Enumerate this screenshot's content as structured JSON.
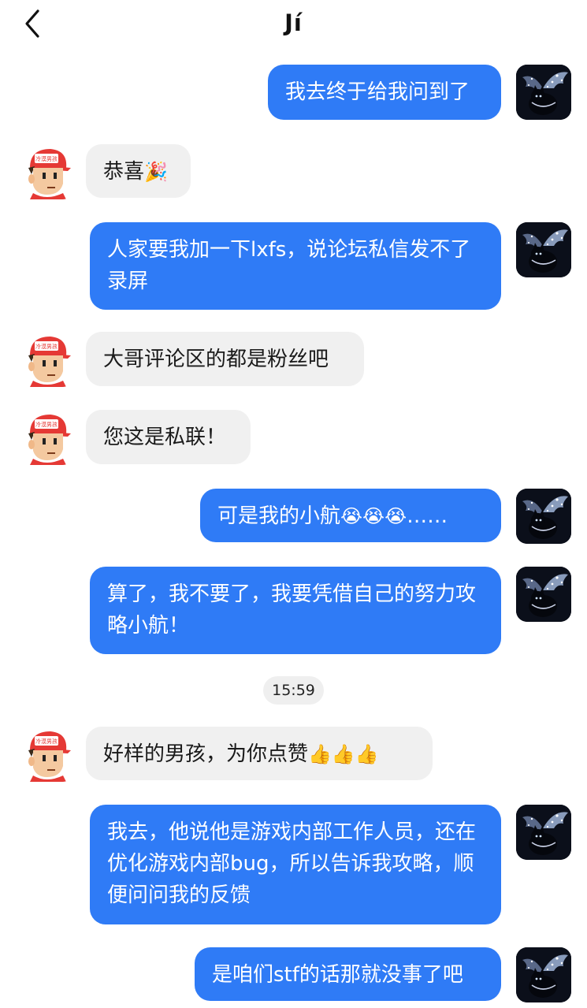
{
  "header": {
    "title": "Jí"
  },
  "timestamp": "15:59",
  "messages": [
    {
      "dir": "out",
      "text": "我去终于给我问到了"
    },
    {
      "dir": "in",
      "text": "恭喜",
      "emoji": "🎉"
    },
    {
      "dir": "out",
      "text": "人家要我加一下lxfs，说论坛私信发不了录屏"
    },
    {
      "dir": "in",
      "text": "大哥评论区的都是粉丝吧"
    },
    {
      "dir": "in",
      "text": "您这是私联！"
    },
    {
      "dir": "out",
      "text": "可是我的小航",
      "emoji": "😭😭😭",
      "suffix": "……"
    },
    {
      "dir": "out",
      "text": "算了，我不要了，我要凭借自己的努力攻略小航！"
    },
    {
      "dir": "in",
      "text": "好样的男孩，为你点赞",
      "emoji": "👍👍👍"
    },
    {
      "dir": "out",
      "text": "我去，他说他是游戏内部工作人员，还在优化游戏内部bug，所以告诉我攻略，顺便问问我的反馈"
    },
    {
      "dir": "out",
      "text": "是咱们stf的话那就没事了吧"
    }
  ],
  "avatars": {
    "other": {
      "hat_text": "冷漠男孩",
      "hat_color": "#e53935"
    },
    "self": {
      "bg_color": "#0b0f1a"
    }
  },
  "colors": {
    "out_bubble": "#2f7bf6",
    "in_bubble": "#f0f0f0"
  }
}
